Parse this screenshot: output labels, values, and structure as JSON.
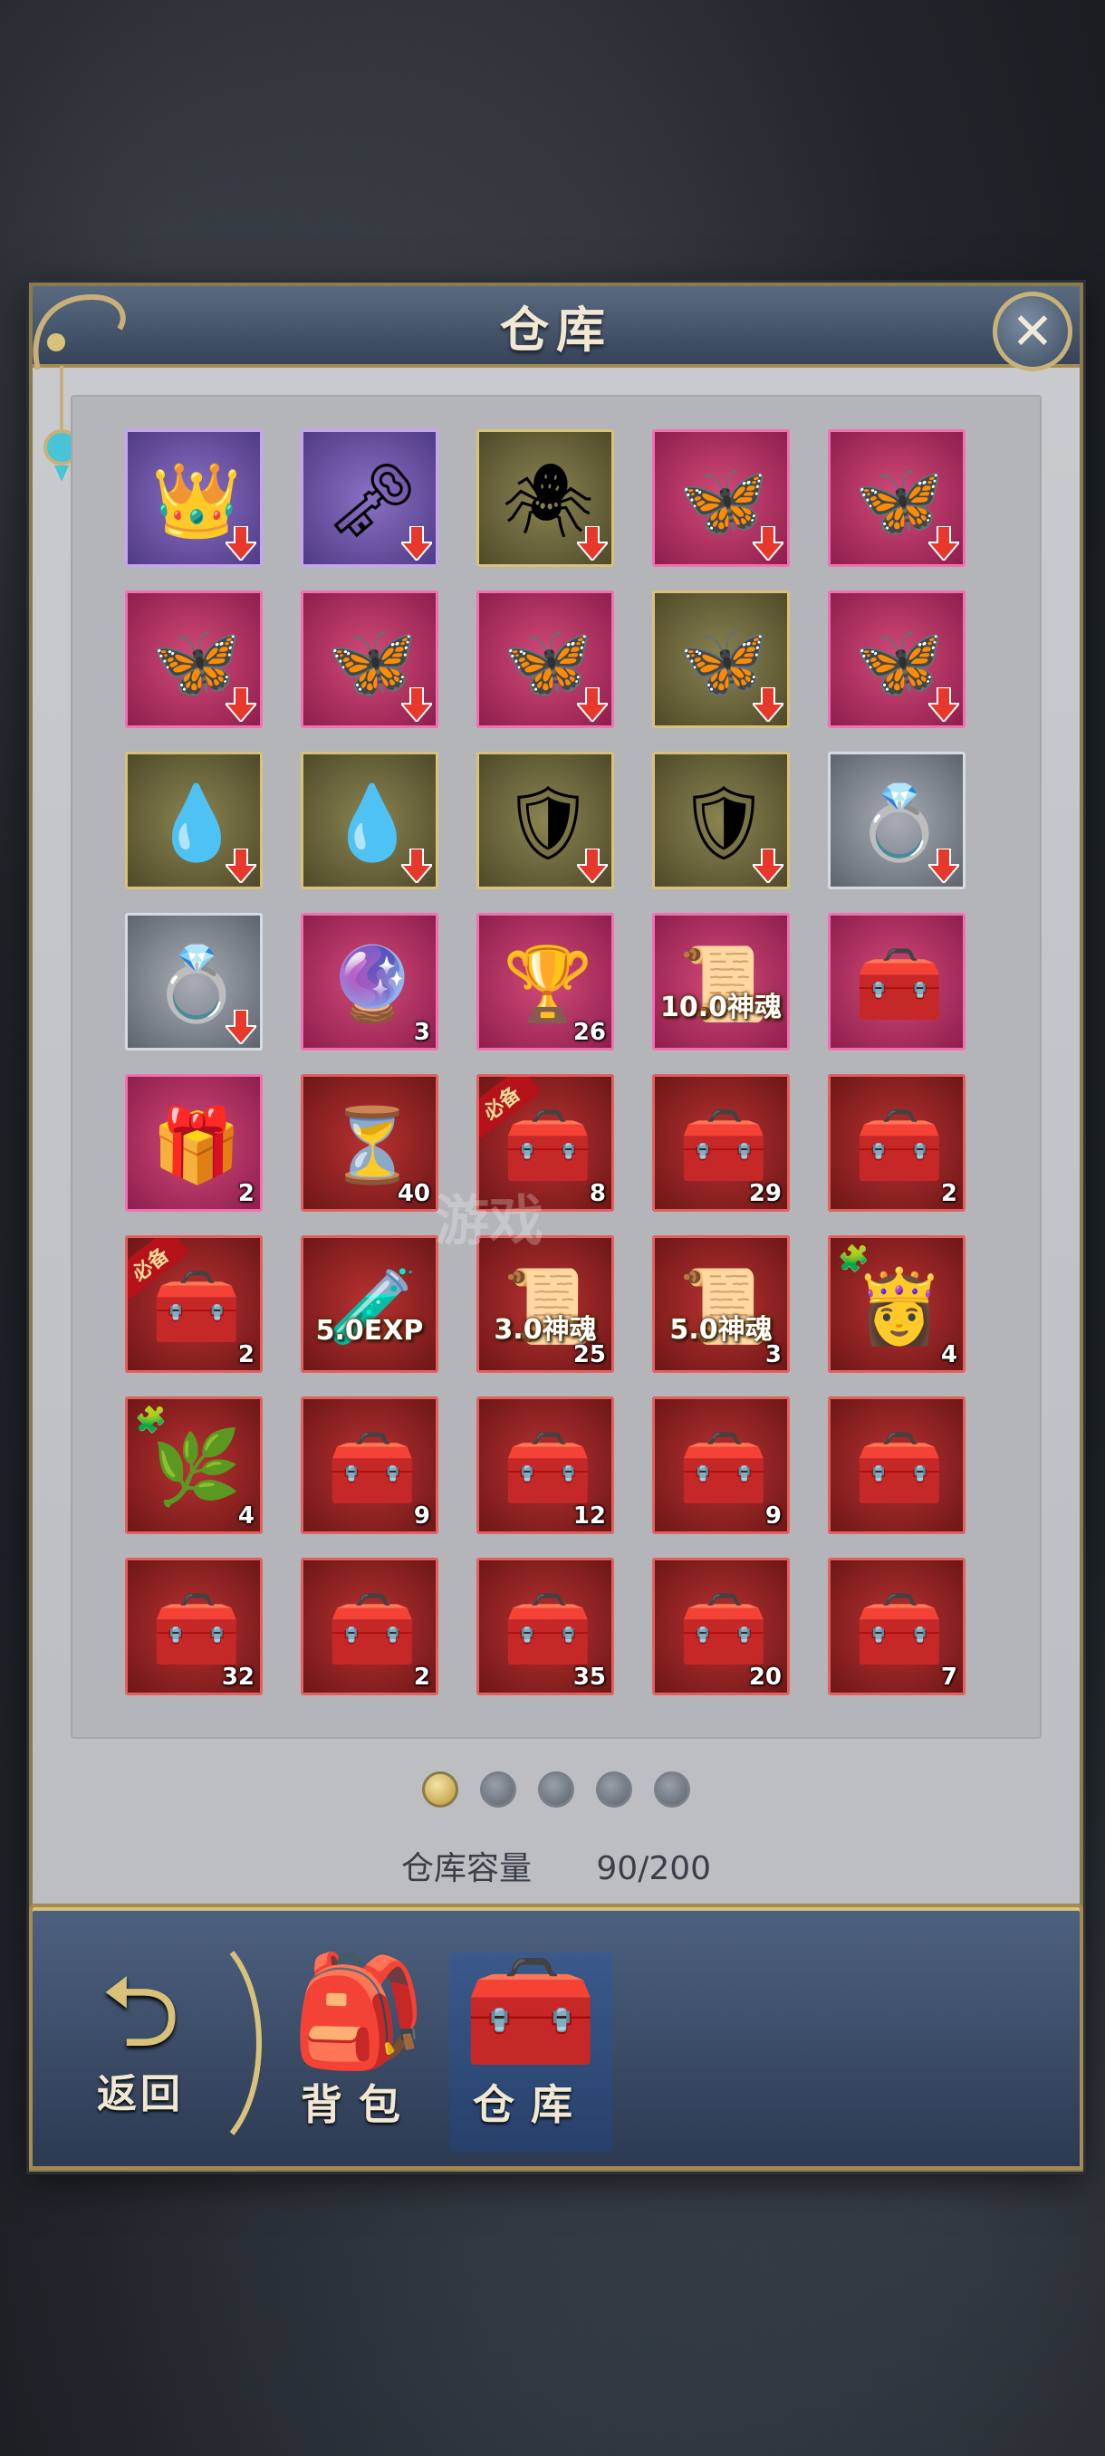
{
  "window": {
    "title": "仓库",
    "close_label": "✕"
  },
  "items": [
    {
      "rarity": "purple",
      "icon": "👑",
      "arrow": true
    },
    {
      "rarity": "purple",
      "icon": "🗝",
      "arrow": true
    },
    {
      "rarity": "gold",
      "icon": "🕷",
      "arrow": true
    },
    {
      "rarity": "pink",
      "icon": "🦋",
      "arrow": true
    },
    {
      "rarity": "pink",
      "icon": "🦋",
      "arrow": true
    },
    {
      "rarity": "pink",
      "icon": "🦋",
      "arrow": true
    },
    {
      "rarity": "pink",
      "icon": "🦋",
      "arrow": true
    },
    {
      "rarity": "pink",
      "icon": "🦋",
      "arrow": true
    },
    {
      "rarity": "gold",
      "icon": "🦋",
      "arrow": true
    },
    {
      "rarity": "pink",
      "icon": "🦋",
      "arrow": true
    },
    {
      "rarity": "gold",
      "icon": "💧",
      "arrow": true
    },
    {
      "rarity": "gold",
      "icon": "💧",
      "arrow": true
    },
    {
      "rarity": "gold",
      "icon": "🛡",
      "arrow": true
    },
    {
      "rarity": "gold",
      "icon": "🛡",
      "arrow": true
    },
    {
      "rarity": "silver",
      "icon": "💍",
      "arrow": true
    },
    {
      "rarity": "silver",
      "icon": "💍",
      "arrow": true
    },
    {
      "rarity": "pink",
      "icon": "🔮",
      "count": "3"
    },
    {
      "rarity": "pink",
      "icon": "🏆",
      "count": "26"
    },
    {
      "rarity": "pink",
      "icon": "📜",
      "overlay": "10.0神魂"
    },
    {
      "rarity": "pink",
      "icon": "🧰"
    },
    {
      "rarity": "pink",
      "icon": "🎁",
      "count": "2"
    },
    {
      "rarity": "red",
      "icon": "⏳",
      "count": "40"
    },
    {
      "rarity": "red",
      "icon": "🧰",
      "count": "8",
      "ribbon": "必备"
    },
    {
      "rarity": "red",
      "icon": "🧰",
      "count": "29"
    },
    {
      "rarity": "red",
      "icon": "🧰",
      "count": "2"
    },
    {
      "rarity": "red",
      "icon": "🧰",
      "count": "2",
      "ribbon": "必备"
    },
    {
      "rarity": "red",
      "icon": "🧪",
      "overlay": "5.0EXP"
    },
    {
      "rarity": "red",
      "icon": "📜",
      "overlay": "3.0神魂",
      "count": "25"
    },
    {
      "rarity": "red",
      "icon": "📜",
      "overlay": "5.0神魂",
      "count": "3"
    },
    {
      "rarity": "red",
      "icon": "👸",
      "count": "4",
      "puzzle": true
    },
    {
      "rarity": "red",
      "icon": "🌿",
      "count": "4",
      "puzzle": true
    },
    {
      "rarity": "red",
      "icon": "🧰",
      "count": "9"
    },
    {
      "rarity": "red",
      "icon": "🧰",
      "count": "12"
    },
    {
      "rarity": "red",
      "icon": "🧰",
      "count": "9"
    },
    {
      "rarity": "red",
      "icon": "🧰"
    },
    {
      "rarity": "red",
      "icon": "🧰",
      "count": "32"
    },
    {
      "rarity": "red",
      "icon": "🧰",
      "count": "2"
    },
    {
      "rarity": "red",
      "icon": "🧰",
      "count": "35"
    },
    {
      "rarity": "red",
      "icon": "🧰",
      "count": "20"
    },
    {
      "rarity": "red",
      "icon": "🧰",
      "count": "7"
    }
  ],
  "pagination": {
    "pages": 5,
    "active": 1
  },
  "capacity": {
    "label": "仓库容量",
    "value": "90/200"
  },
  "bottom_nav": {
    "back_label": "返回",
    "tabs": [
      {
        "label": "背包",
        "icon": "🎒"
      },
      {
        "label": "仓库",
        "icon": "🧰"
      }
    ]
  },
  "watermark": "游戏"
}
